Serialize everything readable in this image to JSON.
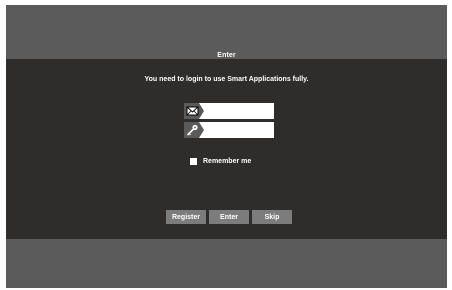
{
  "dialog": {
    "title": "Enter",
    "message": "You need to login to use Smart Applications fully."
  },
  "form": {
    "email": {
      "icon": "envelope-icon",
      "value": "",
      "placeholder": ""
    },
    "password": {
      "icon": "key-icon",
      "value": "",
      "placeholder": ""
    },
    "remember_label": "Remember me",
    "remember_checked": false
  },
  "buttons": {
    "register": "Register",
    "enter": "Enter",
    "skip": "Skip"
  },
  "colors": {
    "screen_bg": "#5b5b5b",
    "panel_bg": "#2f2c2c",
    "button_bg": "#7c7c7c",
    "text": "#ffffff"
  }
}
